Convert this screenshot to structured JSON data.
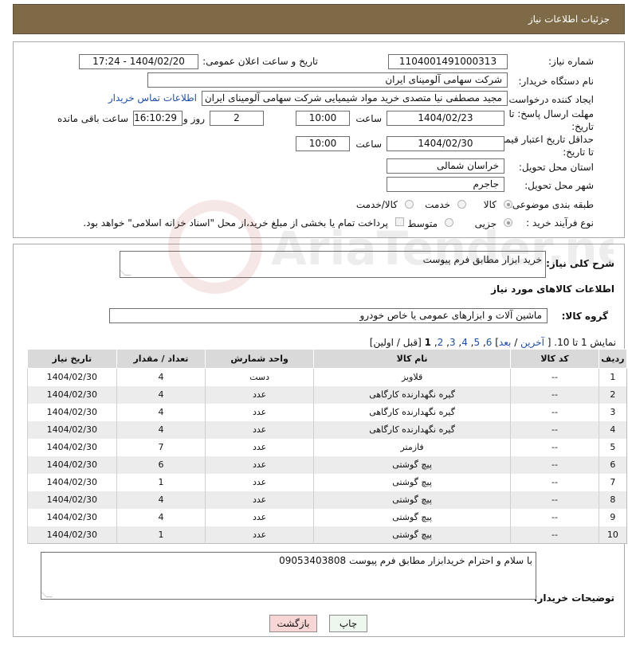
{
  "header": {
    "title": "جزئیات اطلاعات نیاز"
  },
  "form": {
    "need_number": {
      "label": "شماره نیاز:",
      "value": "1104001491000313"
    },
    "announce": {
      "label": "تاریخ و ساعت اعلان عمومی:",
      "value": "1404/02/20 - 17:24"
    },
    "buyer_org": {
      "label": "نام دستگاه خریدار:",
      "value": "شرکت سهامی آلومینای ایران"
    },
    "requester": {
      "label": "ایجاد کننده درخواست:",
      "value": "مجید مصطفی نیا متصدی خرید مواد شیمیایی شرکت سهامی آلومینای ایران",
      "contact_link": "اطلاعات تماس خریدار"
    },
    "reply_deadline": {
      "label_line1": "مهلت ارسال پاسخ: تا",
      "label_line2": "تاریخ:",
      "date": "1404/02/23",
      "time_label": "ساعت",
      "time": "10:00",
      "days": "2",
      "days_label": "روز و",
      "remaining": "16:10:29",
      "remaining_label": "ساعت باقی مانده"
    },
    "price_validity": {
      "label_line1": "حداقل تاریخ اعتبار قیمت:",
      "label_line2": "تا تاریخ:",
      "date": "1404/02/30",
      "time_label": "ساعت",
      "time": "10:00"
    },
    "province": {
      "label": "استان محل تحویل:",
      "value": "خراسان شمالی"
    },
    "city": {
      "label": "شهر محل تحویل:",
      "value": "جاجرم"
    },
    "category": {
      "label": "طبقه بندی موضوعی:",
      "options": [
        "کالا",
        "خدمت",
        "کالا/خدمت"
      ]
    },
    "process": {
      "label": "نوع فرآیند خرید :",
      "options": [
        "جزیی",
        "متوسط"
      ],
      "note": "پرداخت تمام یا بخشی از مبلغ خرید،از محل \"اسناد خزانه اسلامی\" خواهد بود."
    }
  },
  "description": {
    "label": "شرح کلی نیاز:",
    "value": "خرید ابزار مطابق فرم پیوست"
  },
  "goods_section": {
    "title": "اطلاعات کالاهای مورد نیاز"
  },
  "goods_group": {
    "label": "گروه کالا:",
    "value": "ماشین آلات و ابزارهای عمومی یا خاص خودرو"
  },
  "pager": {
    "text": "نمایش 1 تا 10. [",
    "last": "آخرین",
    "sep1": "/",
    "next": "بعد",
    "pages": [
      "6",
      "5",
      "4",
      "3",
      "2"
    ],
    "current": "1",
    "tail": "[قبل / اولین]"
  },
  "table": {
    "headers": [
      "ردیف",
      "کد کالا",
      "نام کالا",
      "واحد شمارش",
      "تعداد / مقدار",
      "تاریخ نیاز"
    ],
    "rows": [
      [
        "1",
        "--",
        "قلاویز",
        "دست",
        "4",
        "1404/02/30"
      ],
      [
        "2",
        "--",
        "گیره نگهدارنده کارگاهی",
        "عدد",
        "4",
        "1404/02/30"
      ],
      [
        "3",
        "--",
        "گیره نگهدارنده کارگاهی",
        "عدد",
        "4",
        "1404/02/30"
      ],
      [
        "4",
        "--",
        "گیره نگهدارنده کارگاهی",
        "عدد",
        "4",
        "1404/02/30"
      ],
      [
        "5",
        "--",
        "فازمتر",
        "عدد",
        "7",
        "1404/02/30"
      ],
      [
        "6",
        "--",
        "پیچ گوشتی",
        "عدد",
        "6",
        "1404/02/30"
      ],
      [
        "7",
        "--",
        "پیچ گوشتی",
        "عدد",
        "1",
        "1404/02/30"
      ],
      [
        "8",
        "--",
        "پیچ گوشتی",
        "عدد",
        "4",
        "1404/02/30"
      ],
      [
        "9",
        "--",
        "پیچ گوشتی",
        "عدد",
        "4",
        "1404/02/30"
      ],
      [
        "10",
        "--",
        "پیچ گوشتی",
        "عدد",
        "1",
        "1404/02/30"
      ]
    ]
  },
  "buyer_notes": {
    "label": "توضیحات خریدار:",
    "value": "با سلام و احترام خریدابزار مطابق فرم پیوست 09053403808"
  },
  "buttons": {
    "print": "چاپ",
    "back": "بازگشت"
  },
  "watermark": {
    "text": "AriaTender.net"
  },
  "colors": {
    "header_bg": "#7f6a47",
    "link": "#1f4ea8",
    "back_button": "#f8d6d6",
    "print_button": "#eef7ee"
  }
}
